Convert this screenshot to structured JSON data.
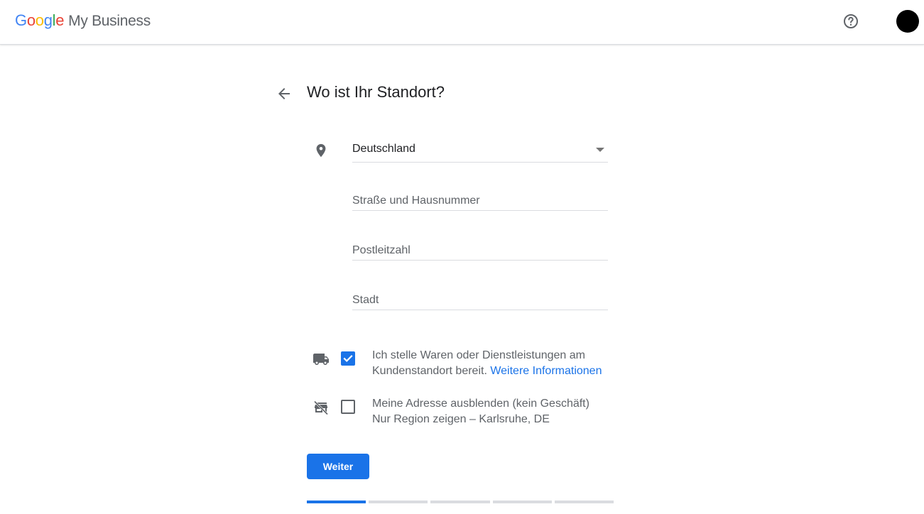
{
  "header": {
    "brand_letters": [
      "G",
      "o",
      "o",
      "g",
      "l",
      "e"
    ],
    "product": "My Business",
    "help_icon": "help-circle-icon",
    "avatar_color": "#000000"
  },
  "page": {
    "title": "Wo ist Ihr Standort?",
    "back_icon": "arrow-back-icon"
  },
  "form": {
    "country_value": "Deutschland",
    "street_placeholder": "Straße und Hausnummer",
    "postal_placeholder": "Postleitzahl",
    "city_placeholder": "Stadt"
  },
  "options": {
    "delivery": {
      "checked": true,
      "text": "Ich stelle Waren oder Dienstleistungen am Kundenstandort bereit.",
      "link": "Weitere Informationen",
      "icon": "truck-icon"
    },
    "hide_address": {
      "checked": false,
      "line1": "Meine Adresse ausblenden (kein Geschäft)",
      "line2": "Nur Region zeigen – Karlsruhe, DE",
      "icon": "store-off-icon"
    }
  },
  "actions": {
    "continue_label": "Weiter"
  },
  "progress": {
    "current_step": 1,
    "total_steps": 5
  },
  "colors": {
    "accent": "#1a73e8",
    "text_secondary": "#5f6368",
    "divider": "#dadce0"
  }
}
